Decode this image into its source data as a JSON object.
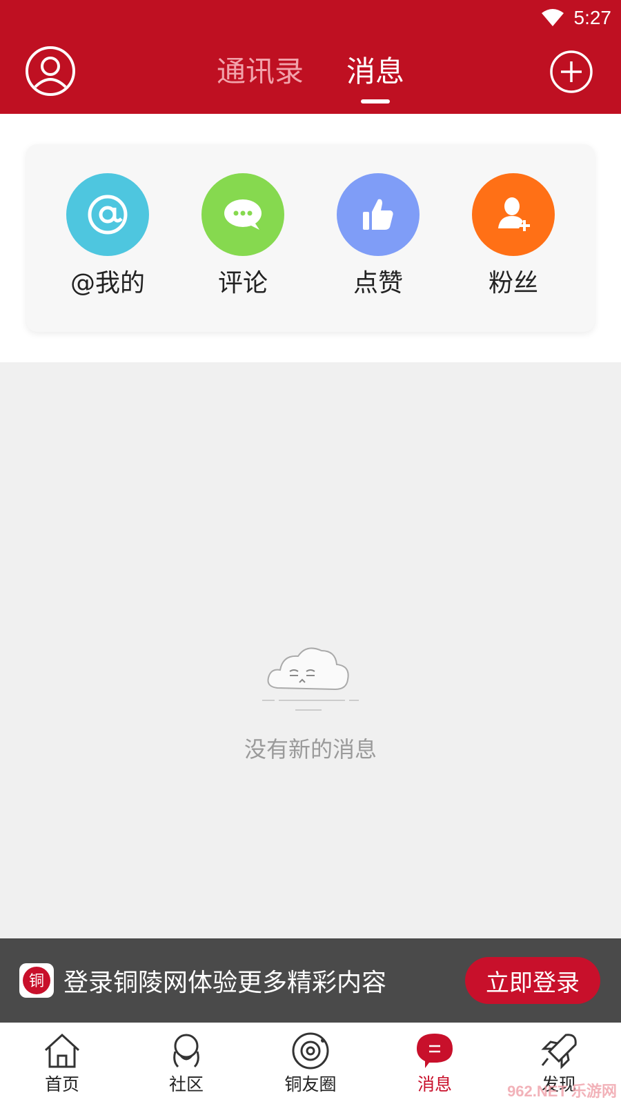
{
  "status_bar": {
    "time": "5:27",
    "wifi_icon": "wifi-icon"
  },
  "header": {
    "tabs": [
      {
        "label": "通讯录",
        "active": false
      },
      {
        "label": "消息",
        "active": true
      }
    ],
    "avatar_icon": "user-circle-icon",
    "add_icon": "plus-circle-icon",
    "bg_color": "#bf1022"
  },
  "shortcuts": [
    {
      "label": "@我的",
      "icon": "at-icon",
      "color": "#4ec6df"
    },
    {
      "label": "评论",
      "icon": "comment-icon",
      "color": "#86d94f"
    },
    {
      "label": "点赞",
      "icon": "thumbs-up-icon",
      "color": "#7f9df7"
    },
    {
      "label": "粉丝",
      "icon": "add-user-icon",
      "color": "#ff7016"
    }
  ],
  "empty_state": {
    "text": "没有新的消息",
    "icon": "cloud-face-icon"
  },
  "login_banner": {
    "logo_char": "铜",
    "text": "登录铜陵网体验更多精彩内容",
    "button_label": "立即登录"
  },
  "bottom_nav": [
    {
      "label": "首页",
      "icon": "home-icon"
    },
    {
      "label": "社区",
      "icon": "community-icon"
    },
    {
      "label": "铜友圈",
      "icon": "circle-icon"
    },
    {
      "label": "消息",
      "icon": "message-icon",
      "active": true
    },
    {
      "label": "发现",
      "icon": "rocket-icon"
    }
  ],
  "watermark": "962.NET 乐游网"
}
